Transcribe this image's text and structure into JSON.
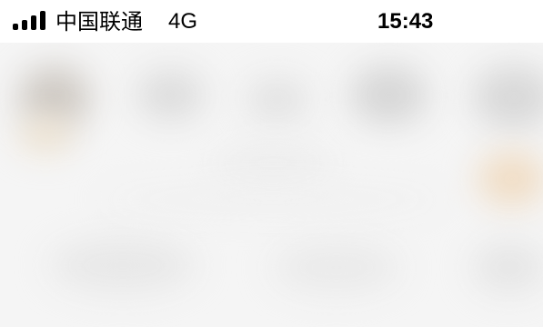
{
  "status_bar": {
    "signal_icon": "cellular-signal-icon",
    "carrier": "中国联通",
    "network": "4G",
    "time": "15:43"
  },
  "content": {
    "state": "blurred",
    "background_color": "#f6f6f6"
  }
}
